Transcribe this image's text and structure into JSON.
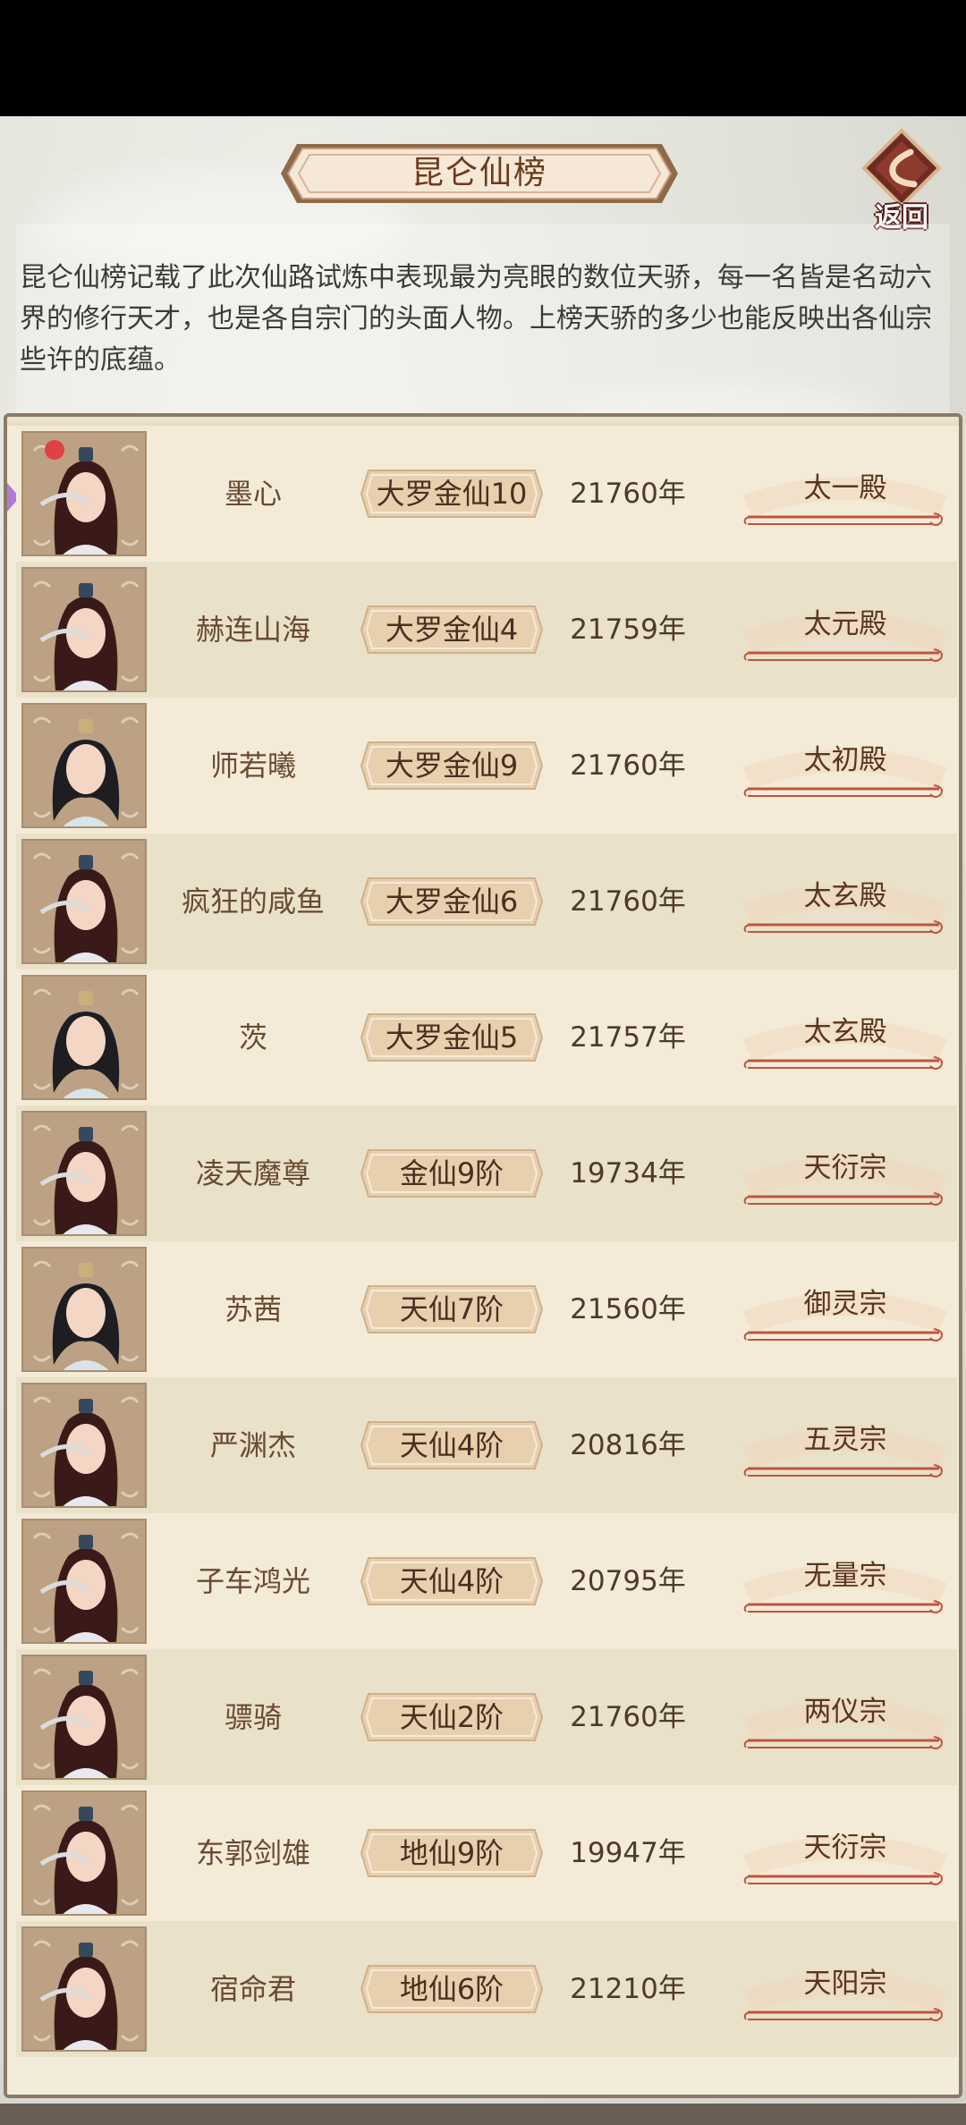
{
  "title": "昆仑仙榜",
  "back_label": "返回",
  "description": "昆仑仙榜记载了此次仙路试炼中表现最为亮眼的数位天骄，每一名皆是名动六界的修行天才，也是各自宗门的头面人物。上榜天骄的多少也能反映出各仙宗些许的底蕴。",
  "rows": [
    {
      "name": "墨心",
      "realm": "大罗金仙10",
      "age": "21760年",
      "sect": "太一殿",
      "avatar": "male-cultivator-avatar",
      "badge": "red-dot"
    },
    {
      "name": "赫连山海",
      "realm": "大罗金仙4",
      "age": "21759年",
      "sect": "太元殿",
      "avatar": "male-cultivator-avatar"
    },
    {
      "name": "师若曦",
      "realm": "大罗金仙9",
      "age": "21760年",
      "sect": "太初殿",
      "avatar": "female-cultivator-avatar"
    },
    {
      "name": "疯狂的咸鱼",
      "realm": "大罗金仙6",
      "age": "21760年",
      "sect": "太玄殿",
      "avatar": "male-cultivator-avatar"
    },
    {
      "name": "茨",
      "realm": "大罗金仙5",
      "age": "21757年",
      "sect": "太玄殿",
      "avatar": "female-cultivator-avatar"
    },
    {
      "name": "凌天魔尊",
      "realm": "金仙9阶",
      "age": "19734年",
      "sect": "天衍宗",
      "avatar": "male-cultivator-avatar"
    },
    {
      "name": "苏茜",
      "realm": "天仙7阶",
      "age": "21560年",
      "sect": "御灵宗",
      "avatar": "female-cultivator-avatar"
    },
    {
      "name": "严渊杰",
      "realm": "天仙4阶",
      "age": "20816年",
      "sect": "五灵宗",
      "avatar": "male-cultivator-avatar"
    },
    {
      "name": "子车鸿光",
      "realm": "天仙4阶",
      "age": "20795年",
      "sect": "无量宗",
      "avatar": "male-cultivator-avatar"
    },
    {
      "name": "骠骑",
      "realm": "天仙2阶",
      "age": "21760年",
      "sect": "两仪宗",
      "avatar": "male-cultivator-avatar"
    },
    {
      "name": "东郭剑雄",
      "realm": "地仙9阶",
      "age": "19947年",
      "sect": "天衍宗",
      "avatar": "male-cultivator-avatar"
    },
    {
      "name": "宿命君",
      "realm": "地仙6阶",
      "age": "21210年",
      "sect": "天阳宗",
      "avatar": "male-cultivator-avatar"
    }
  ]
}
